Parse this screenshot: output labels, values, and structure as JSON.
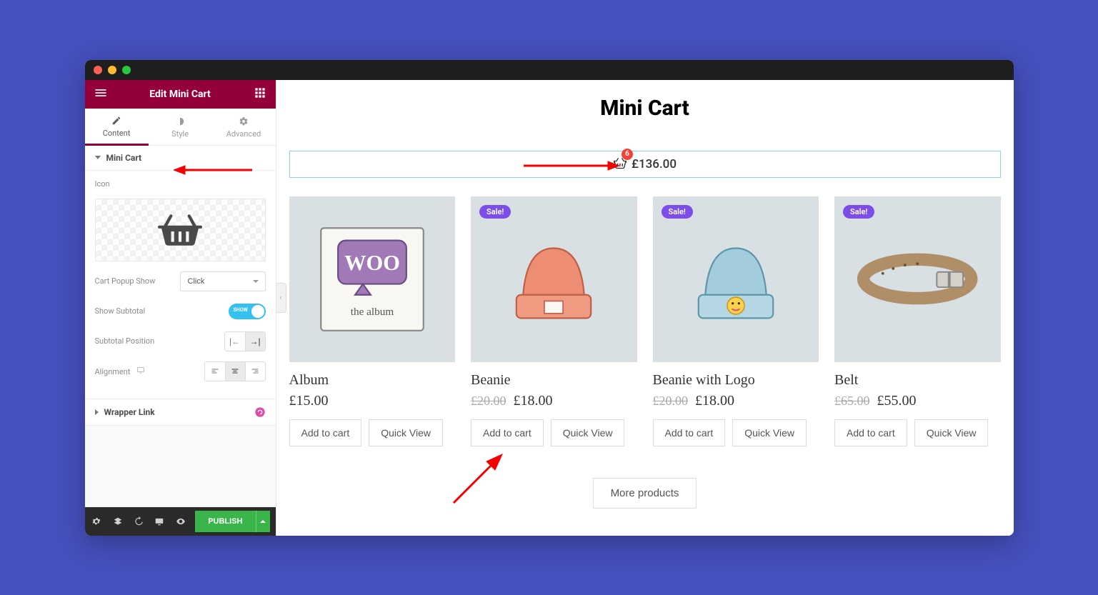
{
  "editor": {
    "title": "Edit Mini Cart",
    "tabs": {
      "content": "Content",
      "style": "Style",
      "advanced": "Advanced"
    },
    "section_mini_cart": "Mini Cart",
    "section_wrapper_link": "Wrapper Link",
    "icon_label": "Icon",
    "cart_popup_show_label": "Cart Popup Show",
    "cart_popup_show_value": "Click",
    "show_subtotal_label": "Show Subtotal",
    "show_subtotal_switch": "SHOW",
    "subtotal_position_label": "Subtotal Position",
    "alignment_label": "Alignment",
    "publish": "PUBLISH"
  },
  "page": {
    "title": "Mini Cart",
    "cart_count": "6",
    "cart_total": "£136.00",
    "sale_badge": "Sale!",
    "add_to_cart": "Add to cart",
    "quick_view": "Quick View",
    "more": "More products",
    "products": [
      {
        "name": "Album",
        "old": "",
        "price": "£15.00",
        "sale": false
      },
      {
        "name": "Beanie",
        "old": "£20.00",
        "price": "£18.00",
        "sale": true
      },
      {
        "name": "Beanie with Logo",
        "old": "£20.00",
        "price": "£18.00",
        "sale": true
      },
      {
        "name": "Belt",
        "old": "£65.00",
        "price": "£55.00",
        "sale": true
      }
    ]
  }
}
